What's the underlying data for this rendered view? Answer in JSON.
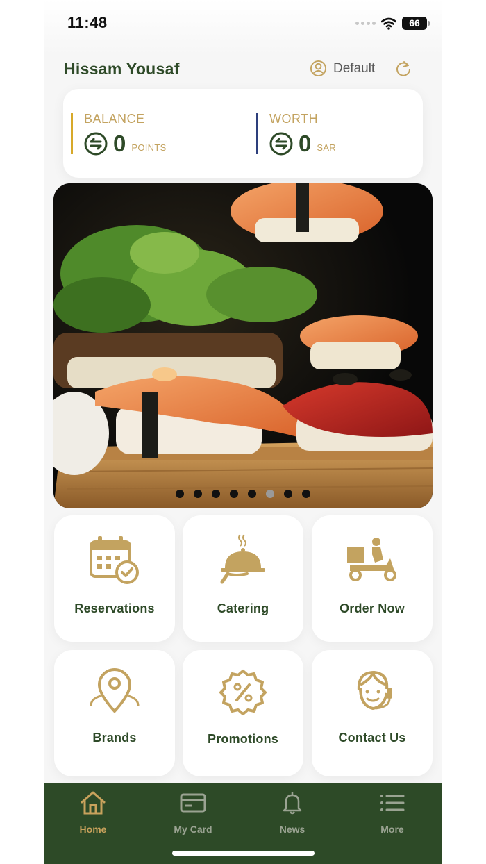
{
  "status_bar": {
    "time": "11:48",
    "battery": "66"
  },
  "header": {
    "user_name": "Hissam Yousaf",
    "tier_label": "Default"
  },
  "balance": {
    "title": "BALANCE",
    "value": "0",
    "unit": "POINTS"
  },
  "worth": {
    "title": "WORTH",
    "value": "0",
    "unit": "SAR"
  },
  "carousel": {
    "slide_count": 8,
    "active_index": 5
  },
  "tiles": [
    {
      "label": "Reservations",
      "icon": "calendar-check-icon"
    },
    {
      "label": "Catering",
      "icon": "cloche-icon"
    },
    {
      "label": "Order Now",
      "icon": "delivery-scooter-icon"
    },
    {
      "label": "Brands",
      "icon": "location-pin-icon"
    },
    {
      "label": "Promotions",
      "icon": "discount-badge-icon"
    },
    {
      "label": "Contact Us",
      "icon": "support-agent-icon"
    }
  ],
  "nav": [
    {
      "label": "Home",
      "icon": "home-icon",
      "active": true
    },
    {
      "label": "My Card",
      "icon": "card-icon",
      "active": false
    },
    {
      "label": "News",
      "icon": "bell-icon",
      "active": false
    },
    {
      "label": "More",
      "icon": "list-icon",
      "active": false
    }
  ],
  "colors": {
    "brand_green": "#2e4a28",
    "gold": "#c3a360",
    "nav_bg": "#2d4a27",
    "worth_bar": "#2d3f7c",
    "balance_bar": "#d7a92a"
  }
}
